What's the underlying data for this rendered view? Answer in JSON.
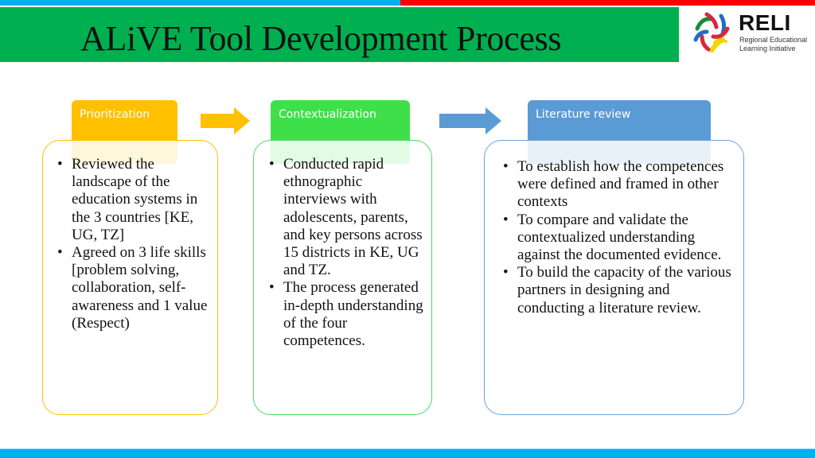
{
  "header": {
    "title": "ALiVE Tool Development Process",
    "colors": {
      "top_bar_left": "#00b0f0",
      "top_bar_right": "#ff0000",
      "banner": "#00b050",
      "bottom_bar": "#00b0f0"
    }
  },
  "logo": {
    "wordmark": "RELI",
    "subtitle_line1": "Regional Educational",
    "subtitle_line2": "Learning Initiative",
    "icon": "reli-logo-icon"
  },
  "stages": [
    {
      "label": "Prioritization",
      "color": "#ffc000",
      "bullets": [
        "Reviewed the landscape of the education systems in the 3 countries [KE, UG, TZ]",
        "Agreed on 3 life skills [problem solving, collaboration, self-awareness and 1 value (Respect)"
      ]
    },
    {
      "label": "Contextualization",
      "color": "#3ee04a",
      "bullets": [
        "Conducted rapid ethnographic interviews with adolescents, parents, and key persons across 15 districts in KE, UG and TZ.",
        "The process generated in-depth understanding of the four competences."
      ]
    },
    {
      "label": "Literature review",
      "color": "#5b9bd5",
      "bullets": [
        "To establish how the competences were defined and framed in other contexts",
        "To compare and validate the contextualized understanding against the documented evidence.",
        "To build the capacity of the various partners in designing and conducting a literature review."
      ]
    }
  ],
  "arrows": [
    {
      "icon": "arrow-right-icon",
      "color": "#ffc000"
    },
    {
      "icon": "arrow-right-icon",
      "color": "#5b9bd5"
    }
  ]
}
